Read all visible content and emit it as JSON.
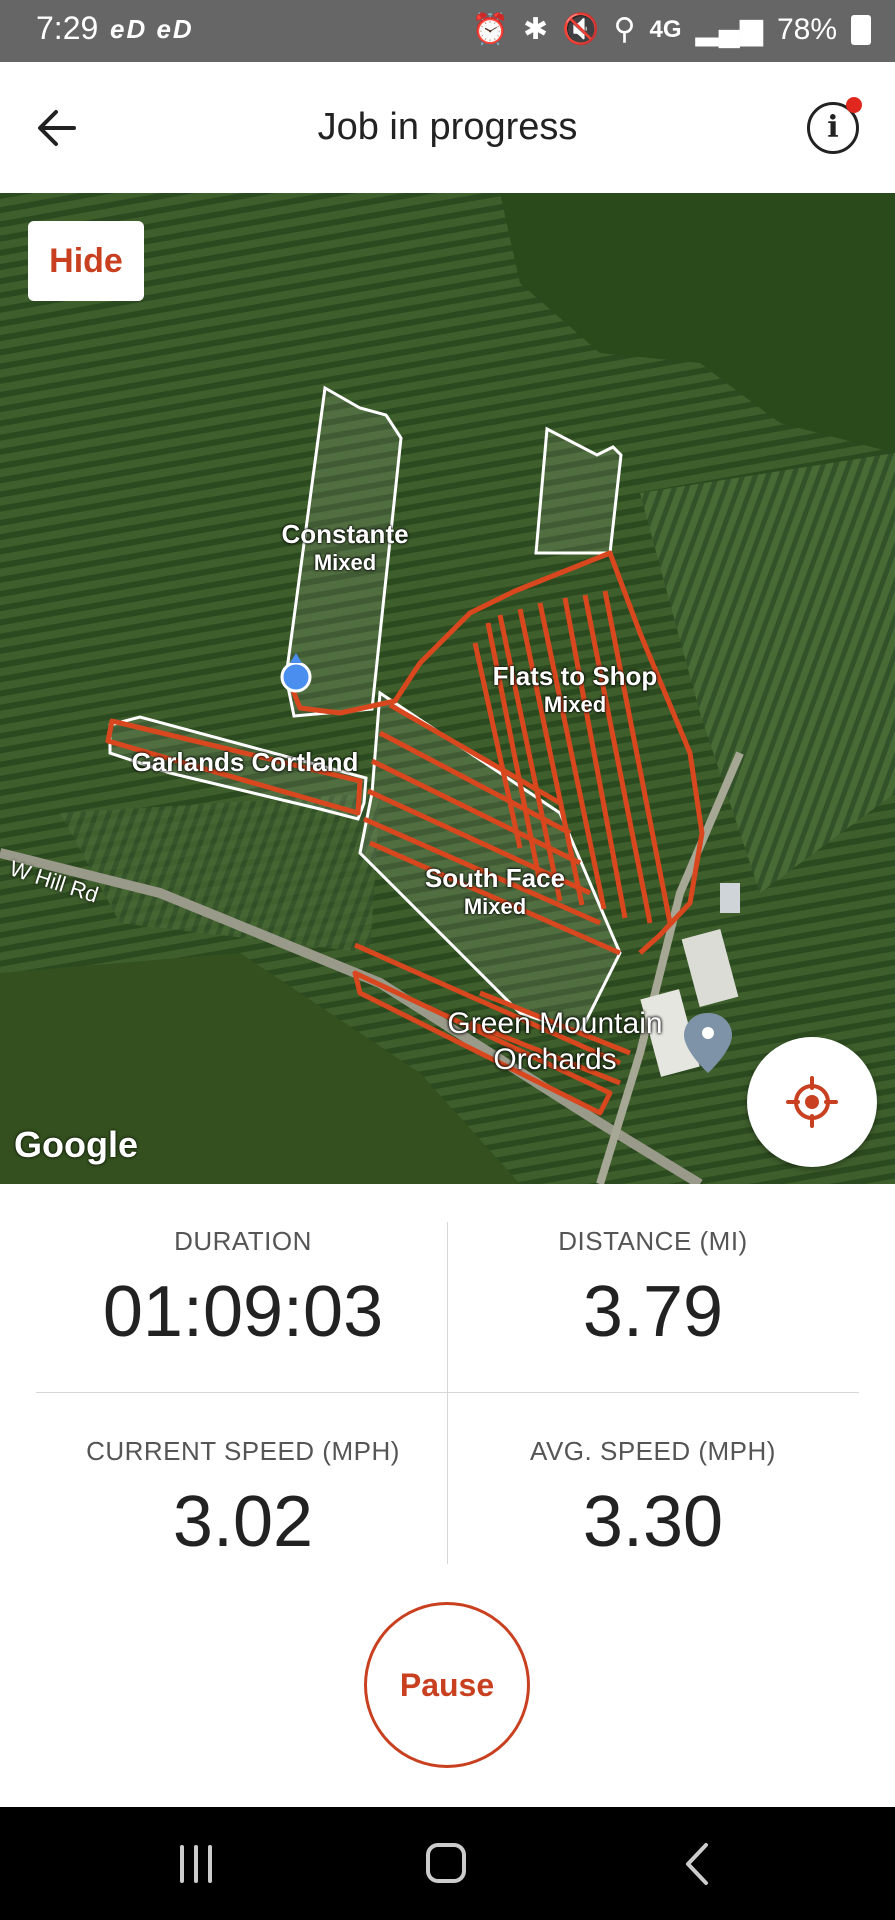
{
  "status_bar": {
    "time": "7:29",
    "left_icons": "eD eD",
    "network": "4G",
    "battery": "78%"
  },
  "header": {
    "title": "Job in progress"
  },
  "map": {
    "hide_label": "Hide",
    "fields": [
      {
        "name": "Constante",
        "type": "Mixed"
      },
      {
        "name": "Flats to Shop",
        "type": "Mixed"
      },
      {
        "name": "Garlands Cortland",
        "type": ""
      },
      {
        "name": "South Face",
        "type": "Mixed"
      }
    ],
    "place": "Green Mountain Orchards",
    "road": "W Hill Rd",
    "attribution": "Google",
    "track_color": "#d9471f"
  },
  "stats": {
    "duration": {
      "label": "DURATION",
      "value": "01:09:03"
    },
    "distance": {
      "label": "DISTANCE (MI)",
      "value": "3.79"
    },
    "current_speed": {
      "label": "CURRENT SPEED (MPH)",
      "value": "3.02"
    },
    "avg_speed": {
      "label": "AVG. SPEED (MPH)",
      "value": "3.30"
    }
  },
  "actions": {
    "pause_label": "Pause"
  },
  "colors": {
    "accent": "#c8401f",
    "status_bar": "#666666"
  }
}
